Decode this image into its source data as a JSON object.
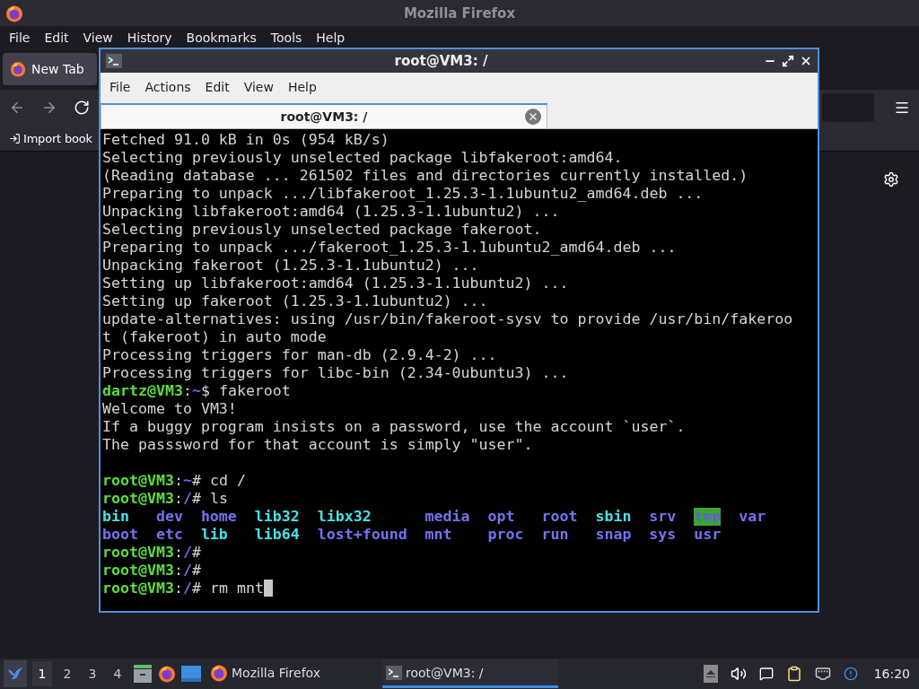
{
  "firefox": {
    "title": "Mozilla Firefox",
    "menu": [
      {
        "label": "File"
      },
      {
        "label": "Edit"
      },
      {
        "label": "View"
      },
      {
        "label": "History"
      },
      {
        "label": "Bookmarks"
      },
      {
        "label": "Tools"
      },
      {
        "label": "Help"
      }
    ],
    "tabs": [
      {
        "label": "New Tab",
        "selected": true
      }
    ],
    "bookmarks": [
      {
        "label": "Import book"
      }
    ]
  },
  "terminal": {
    "title": "root@VM3: /",
    "menu": [
      {
        "label": "File"
      },
      {
        "label": "Actions"
      },
      {
        "label": "Edit"
      },
      {
        "label": "View"
      },
      {
        "label": "Help"
      }
    ],
    "tabs": [
      {
        "label": "root@VM3: /",
        "selected": true
      }
    ],
    "lines": [
      {
        "kind": "output",
        "text": "Fetched 91.0 kB in 0s (954 kB/s)"
      },
      {
        "kind": "output",
        "text": "Selecting previously unselected package libfakeroot:amd64."
      },
      {
        "kind": "output",
        "text": "(Reading database ... 261502 files and directories currently installed.)"
      },
      {
        "kind": "output",
        "text": "Preparing to unpack .../libfakeroot_1.25.3-1.1ubuntu2_amd64.deb ..."
      },
      {
        "kind": "output",
        "text": "Unpacking libfakeroot:amd64 (1.25.3-1.1ubuntu2) ..."
      },
      {
        "kind": "output",
        "text": "Selecting previously unselected package fakeroot."
      },
      {
        "kind": "output",
        "text": "Preparing to unpack .../fakeroot_1.25.3-1.1ubuntu2_amd64.deb ..."
      },
      {
        "kind": "output",
        "text": "Unpacking fakeroot (1.25.3-1.1ubuntu2) ..."
      },
      {
        "kind": "output",
        "text": "Setting up libfakeroot:amd64 (1.25.3-1.1ubuntu2) ..."
      },
      {
        "kind": "output",
        "text": "Setting up fakeroot (1.25.3-1.1ubuntu2) ..."
      },
      {
        "kind": "output",
        "text": "update-alternatives: using /usr/bin/fakeroot-sysv to provide /usr/bin/fakeroo"
      },
      {
        "kind": "output",
        "text": "t (fakeroot) in auto mode"
      },
      {
        "kind": "output",
        "text": "Processing triggers for man-db (2.9.4-2) ..."
      },
      {
        "kind": "output",
        "text": "Processing triggers for libc-bin (2.34-0ubuntu3) ..."
      },
      {
        "kind": "prompt",
        "user": "dartz@VM3",
        "colon": ":",
        "path": "~",
        "symbol": "$",
        "command": "fakeroot",
        "cursor": false
      },
      {
        "kind": "output",
        "text": "Welcome to VM3!"
      },
      {
        "kind": "output",
        "text": "If a buggy program insists on a password, use the account `user`."
      },
      {
        "kind": "output",
        "text": "The passsword for that account is simply \"user\"."
      },
      {
        "kind": "blank"
      },
      {
        "kind": "prompt",
        "user": "root@VM3",
        "colon": ":",
        "path": "~",
        "symbol": "#",
        "command": "cd /",
        "cursor": false
      },
      {
        "kind": "prompt",
        "user": "root@VM3",
        "colon": ":",
        "path": "/",
        "symbol": "#",
        "command": "ls",
        "cursor": false
      },
      {
        "kind": "listing",
        "entries": [
          {
            "name": "bin",
            "kind": "link"
          },
          {
            "name": "dev",
            "kind": "dir"
          },
          {
            "name": "home",
            "kind": "dir"
          },
          {
            "name": "lib32",
            "kind": "link"
          },
          {
            "name": "libx32",
            "kind": "link"
          },
          {
            "name": "media",
            "kind": "dir"
          },
          {
            "name": "opt",
            "kind": "dir"
          },
          {
            "name": "root",
            "kind": "dir"
          },
          {
            "name": "sbin",
            "kind": "link"
          },
          {
            "name": "srv",
            "kind": "dir"
          },
          {
            "name": "tmp",
            "kind": "sticky"
          },
          {
            "name": "var",
            "kind": "dir"
          }
        ]
      },
      {
        "kind": "listing",
        "entries": [
          {
            "name": "boot",
            "kind": "dir"
          },
          {
            "name": "etc",
            "kind": "dir"
          },
          {
            "name": "lib",
            "kind": "link"
          },
          {
            "name": "lib64",
            "kind": "link"
          },
          {
            "name": "lost+found",
            "kind": "dir"
          },
          {
            "name": "mnt",
            "kind": "dir"
          },
          {
            "name": "proc",
            "kind": "dir"
          },
          {
            "name": "run",
            "kind": "dir"
          },
          {
            "name": "snap",
            "kind": "dir"
          },
          {
            "name": "sys",
            "kind": "dir"
          },
          {
            "name": "usr",
            "kind": "dir"
          }
        ]
      },
      {
        "kind": "prompt",
        "user": "root@VM3",
        "colon": ":",
        "path": "/",
        "symbol": "#",
        "cursor": false
      },
      {
        "kind": "prompt",
        "user": "root@VM3",
        "colon": ":",
        "path": "/",
        "symbol": "#",
        "cursor": false
      },
      {
        "kind": "prompt",
        "user": "root@VM3",
        "colon": ":",
        "path": "/",
        "symbol": "#",
        "command": "rm mnt",
        "cursor": true
      }
    ]
  },
  "taskbar": {
    "workspaces": [
      {
        "label": "1",
        "selected": true
      },
      {
        "label": "2",
        "selected": false
      },
      {
        "label": "3",
        "selected": false
      },
      {
        "label": "4",
        "selected": false
      }
    ],
    "tasks": [
      {
        "label": "Mozilla Firefox",
        "kind": "browser",
        "selected": false
      },
      {
        "label": "root@VM3: /",
        "kind": "terminal",
        "selected": true
      }
    ],
    "clock": "16:20"
  }
}
